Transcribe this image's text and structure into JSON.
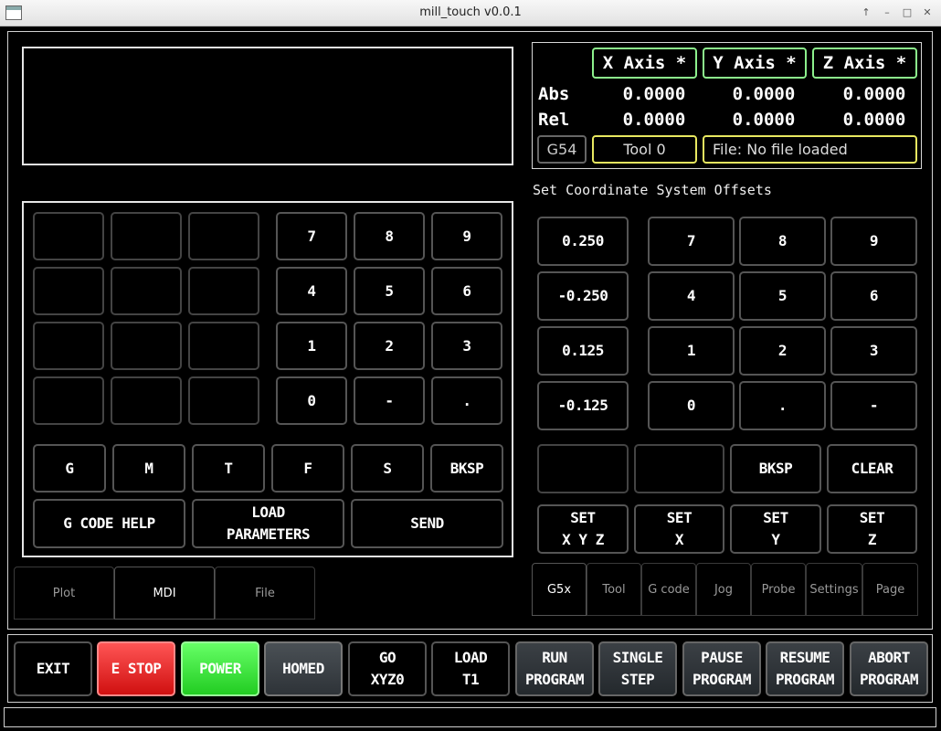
{
  "window": {
    "title": "mill_touch v0.0.1",
    "controls": [
      "↑",
      "–",
      "□",
      "✕"
    ]
  },
  "dro": {
    "axes": [
      "X Axis *",
      "Y Axis *",
      "Z Axis *"
    ],
    "rows": [
      {
        "label": "Abs",
        "values": [
          "0.0000",
          "0.0000",
          "0.0000"
        ]
      },
      {
        "label": "Rel",
        "values": [
          "0.0000",
          "0.0000",
          "0.0000"
        ]
      }
    ],
    "coord_system": "G54",
    "tool": "Tool 0",
    "file": "File: No file loaded"
  },
  "mdi_keypad": {
    "digits": [
      "7",
      "8",
      "9",
      "4",
      "5",
      "6",
      "1",
      "2",
      "3",
      "0",
      "-",
      "."
    ],
    "letters": [
      "G",
      "M",
      "T",
      "F",
      "S",
      "BKSP"
    ],
    "actions": [
      "G CODE HELP",
      "LOAD\nPARAMETERS",
      "SEND"
    ]
  },
  "offsets": {
    "heading": "Set Coordinate System Offsets",
    "presets": [
      "0.250",
      "-0.250",
      "0.125",
      "-0.125"
    ],
    "digits": [
      "7",
      "8",
      "9",
      "4",
      "5",
      "6",
      "1",
      "2",
      "3",
      "0",
      ".",
      "-"
    ],
    "edit": [
      "BKSP",
      "CLEAR"
    ],
    "set": [
      "SET\nX Y Z",
      "SET\nX",
      "SET\nY",
      "SET\nZ"
    ]
  },
  "left_tabs": {
    "items": [
      "Plot",
      "MDI",
      "File"
    ],
    "active": "MDI"
  },
  "right_tabs": {
    "items": [
      "G5x",
      "Tool",
      "G code",
      "Jog",
      "Probe",
      "Settings",
      "Page"
    ],
    "active": "G5x"
  },
  "bottom_bar": [
    "EXIT",
    "E STOP",
    "POWER",
    "HOMED",
    "GO\nXYZ0",
    "LOAD\nT1",
    "RUN\nPROGRAM",
    "SINGLE\nSTEP",
    "PAUSE\nPROGRAM",
    "RESUME\nPROGRAM",
    "ABORT\nPROGRAM"
  ],
  "colors": {
    "estop": "#e02020",
    "power": "#33dd33",
    "axis_border": "#8cf08c",
    "status_border": "#e8e860"
  }
}
